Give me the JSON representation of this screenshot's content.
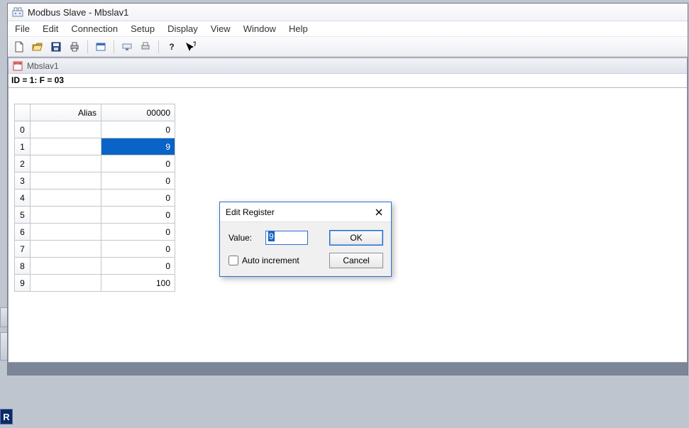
{
  "app": {
    "title": "Modbus Slave - Mbslav1"
  },
  "menu": {
    "items": [
      "File",
      "Edit",
      "Connection",
      "Setup",
      "Display",
      "View",
      "Window",
      "Help"
    ]
  },
  "toolbar": {
    "buttons": [
      "new",
      "open",
      "save",
      "print",
      "window",
      "connect",
      "print2",
      "help",
      "whats-this"
    ]
  },
  "child": {
    "title": "Mbslav1",
    "status": "ID = 1: F = 03",
    "columns": {
      "alias": "Alias",
      "value": "00000"
    },
    "rows": [
      {
        "idx": "0",
        "alias": "",
        "value": "0",
        "selected": false
      },
      {
        "idx": "1",
        "alias": "",
        "value": "9",
        "selected": true
      },
      {
        "idx": "2",
        "alias": "",
        "value": "0",
        "selected": false
      },
      {
        "idx": "3",
        "alias": "",
        "value": "0",
        "selected": false
      },
      {
        "idx": "4",
        "alias": "",
        "value": "0",
        "selected": false
      },
      {
        "idx": "5",
        "alias": "",
        "value": "0",
        "selected": false
      },
      {
        "idx": "6",
        "alias": "",
        "value": "0",
        "selected": false
      },
      {
        "idx": "7",
        "alias": "",
        "value": "0",
        "selected": false
      },
      {
        "idx": "8",
        "alias": "",
        "value": "0",
        "selected": false
      },
      {
        "idx": "9",
        "alias": "",
        "value": "100",
        "selected": false
      }
    ]
  },
  "dialog": {
    "title": "Edit Register",
    "value_label": "Value:",
    "value": "9",
    "auto_increment_label": "Auto increment",
    "auto_increment_checked": false,
    "ok": "OK",
    "cancel": "Cancel"
  },
  "bg": {
    "R": "R"
  }
}
